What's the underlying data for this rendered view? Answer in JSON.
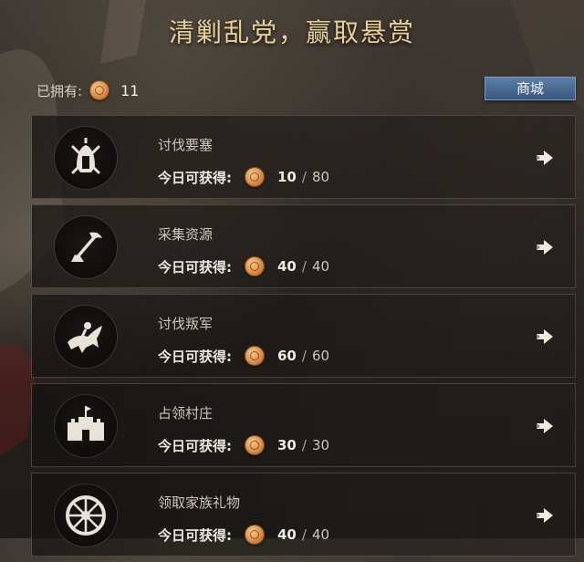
{
  "title": "清剿乱党，赢取悬赏",
  "currency": {
    "owned_label": "已拥有:",
    "owned_value": "11",
    "icon": "bounty-coin-icon"
  },
  "shop_button": "商城",
  "reward_label": "今日可获得:",
  "tasks": [
    {
      "name": "讨伐要塞",
      "current": "10",
      "max": "80",
      "icon": "helmet-swords-icon"
    },
    {
      "name": "采集资源",
      "current": "40",
      "max": "40",
      "icon": "pickaxe-icon"
    },
    {
      "name": "讨伐叛军",
      "current": "60",
      "max": "60",
      "icon": "rider-icon"
    },
    {
      "name": "占领村庄",
      "current": "30",
      "max": "30",
      "icon": "castle-icon"
    },
    {
      "name": "领取家族礼物",
      "current": "40",
      "max": "40",
      "icon": "wheel-icon"
    }
  ]
}
